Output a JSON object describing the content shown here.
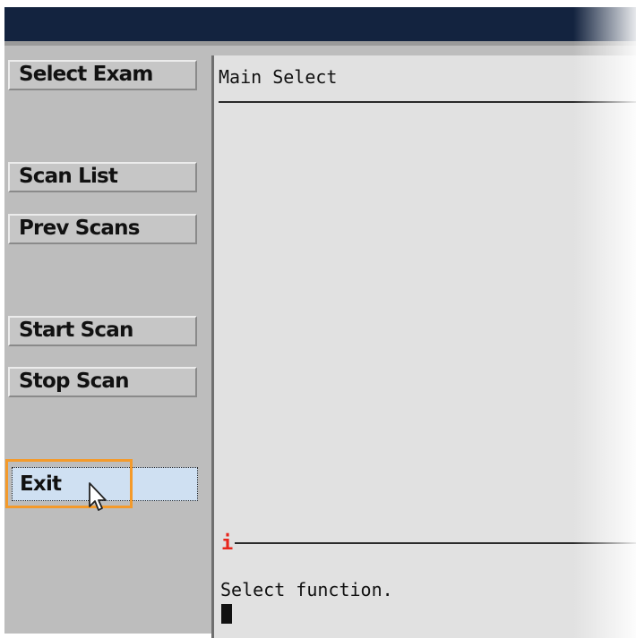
{
  "sidebar": {
    "buttons": [
      {
        "label": "Select Exam"
      },
      {
        "label": "Scan List"
      },
      {
        "label": "Prev Scans"
      },
      {
        "label": "Start Scan"
      },
      {
        "label": "Stop Scan"
      },
      {
        "label": "Exit"
      }
    ]
  },
  "main": {
    "title": "Main Select",
    "info_marker": "i",
    "status": "Select function."
  },
  "icons": {
    "cursor": "mouse-pointer-icon",
    "info": "info-icon"
  },
  "colors": {
    "titlebar": "#13233f",
    "highlight": "#f49a2a",
    "info": "#e8261c"
  }
}
